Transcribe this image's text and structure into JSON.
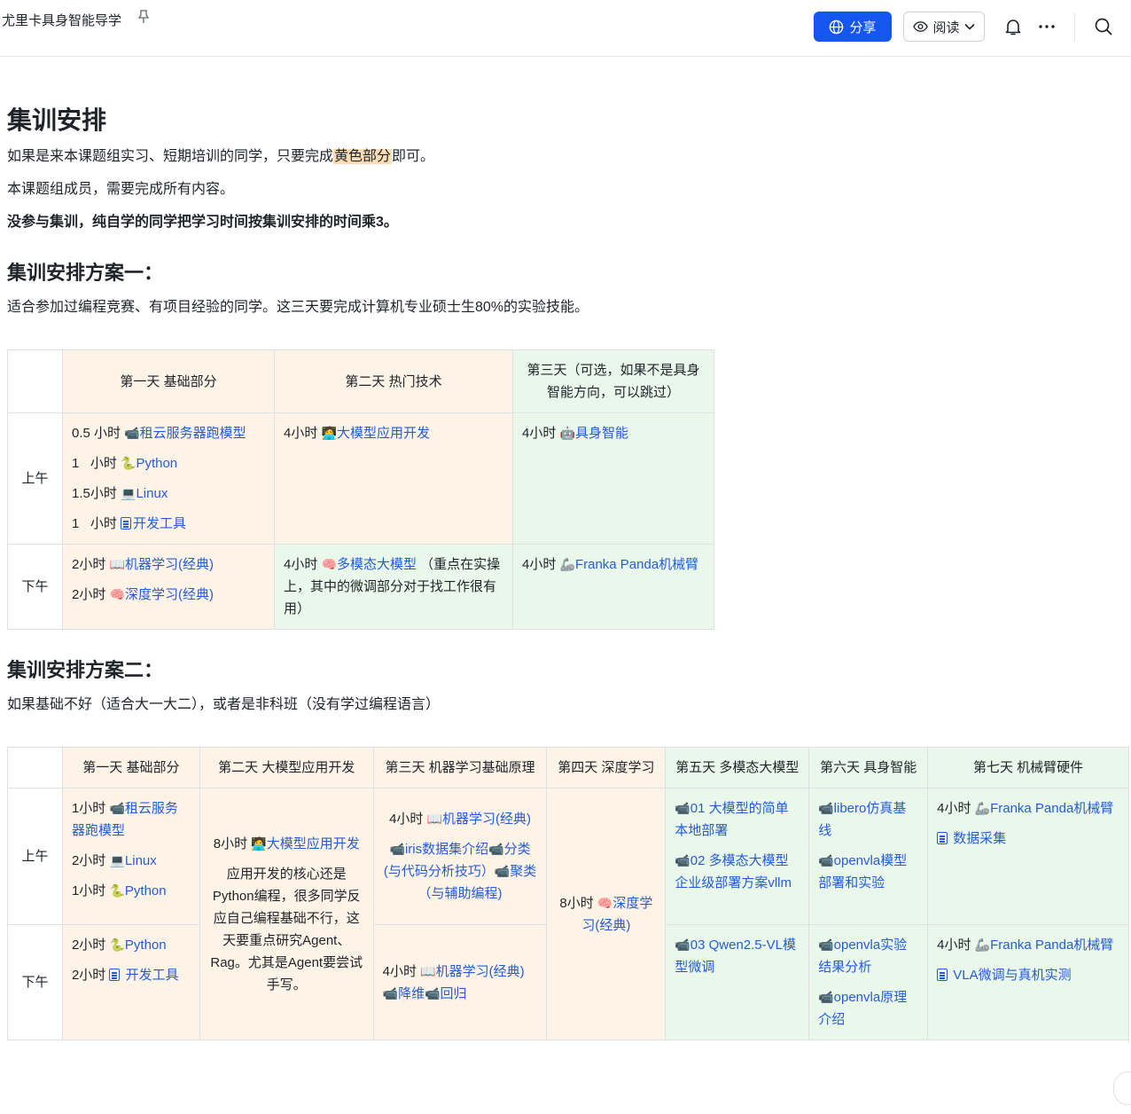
{
  "header": {
    "doc_title": "尤里卡具身智能导学",
    "share_label": "分享",
    "read_label": "阅读"
  },
  "intro": {
    "title": "集训安排",
    "p1_before": "如果是来本课题组实习、短期培训的同学，只要完成",
    "p1_highlight": "黄色部分",
    "p1_after": "即可。",
    "p2": "本课题组成员，需要完成所有内容。",
    "p3": "没参与集训，纯自学的同学把学习时间按集训安排的时间乘3。"
  },
  "plan1": {
    "title": "集训安排方案一：",
    "desc": "适合参加过编程竞赛、有项目经验的同学。这三天要完成计算机专业硕士生80%的实验技能。",
    "headers": [
      "第一天 基础部分",
      "第二天 热门技术",
      "第三天（可选，如果不是具身智能方向，可以跳过）"
    ],
    "row_am": "上午",
    "row_pm": "下午",
    "d1_am": [
      {
        "time": "0.5 小时 ",
        "icon": "📹",
        "link": "租云服务器跑模型"
      },
      {
        "time": "1   小时 ",
        "icon": "🐍",
        "link": "Python"
      },
      {
        "time": "1.5小时 ",
        "icon": "💻",
        "link": "Linux"
      },
      {
        "time": "1   小时 ",
        "icon": "doc",
        "link": "开发工具"
      }
    ],
    "d2_am": {
      "time": "4小时 ",
      "icon": "🧑‍💻",
      "link": "大模型应用开发"
    },
    "d3_am": {
      "time": "4小时 ",
      "icon": "🤖",
      "link": "具身智能"
    },
    "d1_pm": [
      {
        "time": "2小时 ",
        "icon": "📖",
        "link": "机器学习(经典)"
      },
      {
        "time": "2小时 ",
        "icon": "🧠",
        "link": "深度学习(经典)"
      }
    ],
    "d2_pm": {
      "time": "4小时 ",
      "icon": "🧠",
      "link": "多模态大模型",
      "note": " （重点在实操上，其中的微调部分对于找工作很有用）"
    },
    "d3_pm": {
      "time": "4小时 ",
      "icon": "🦾",
      "link": "Franka Panda机械臂"
    }
  },
  "plan2": {
    "title": "集训安排方案二：",
    "desc": "如果基础不好（适合大一大二），或者是非科班（没有学过编程语言）",
    "headers": [
      "第一天 基础部分",
      "第二天 大模型应用开发",
      "第三天 机器学习基础原理",
      "第四天 深度学习",
      "第五天 多模态大模型",
      "第六天 具身智能",
      "第七天 机械臂硬件"
    ],
    "row_am": "上午",
    "row_pm": "下午",
    "d1_am": [
      {
        "time": "1小时 ",
        "icon": "📹",
        "link": "租云服务器跑模型"
      },
      {
        "time": "2小时 ",
        "icon": "💻",
        "link": "Linux"
      },
      {
        "time": "1小时 ",
        "icon": "🐍",
        "link": "Python"
      }
    ],
    "d1_pm": [
      {
        "time": "2小时 ",
        "icon": "🐍",
        "link": "Python"
      },
      {
        "time": "2小时 ",
        "icon": "doc",
        "link": "开发工具"
      }
    ],
    "d2": {
      "time": "8小时 ",
      "icon": "🧑‍💻",
      "link": "大模型应用开发",
      "note": "应用开发的核心还是Python编程，很多同学反应自己编程基础不行，这天要重点研究Agent、Rag。尤其是Agent要尝试手写。"
    },
    "d3_am_line1": {
      "time": "4小时 ",
      "icon": "📖",
      "link": "机器学习(经典)"
    },
    "d3_am_links": [
      {
        "icon": "📹",
        "link": "iris数据集介绍"
      },
      {
        "icon": "📹",
        "link": "分类(与代码分析技巧）"
      },
      {
        "icon": "📹",
        "link": "聚类（与辅助编程)"
      }
    ],
    "d3_pm_line1": {
      "time": "4小时 ",
      "icon": "📖",
      "link": "机器学习(经典)"
    },
    "d3_pm_links": [
      {
        "icon": "📹",
        "link": "降维"
      },
      {
        "icon": "📹",
        "link": "回归"
      }
    ],
    "d4": {
      "time": "8小时 ",
      "icon": "🧠",
      "link": "深度学习(经典)"
    },
    "d5_am": [
      {
        "icon": "📹",
        "link": "01 大模型的简单本地部署"
      },
      {
        "icon": "📹",
        "link": "02 多模态大模型企业级部署方案vllm"
      }
    ],
    "d5_pm": [
      {
        "icon": "📹",
        "link": "03 Qwen2.5-VL模型微调"
      }
    ],
    "d6_am": [
      {
        "icon": "📹",
        "link": "libero仿真基线"
      },
      {
        "icon": "📹",
        "link": "openvla模型部署和实验"
      }
    ],
    "d6_pm": [
      {
        "icon": "📹",
        "link": "openvla实验结果分析"
      },
      {
        "icon": "📹",
        "link": "openvla原理介绍"
      }
    ],
    "d7_am": [
      {
        "time": "4小时 ",
        "icon": "🦾",
        "link": "Franka Panda机械臂"
      },
      {
        "time": "",
        "icon": "doc",
        "link": "数据采集"
      }
    ],
    "d7_pm": [
      {
        "time": "4小时 ",
        "icon": "🦾",
        "link": "Franka Panda机械臂"
      },
      {
        "time": "",
        "icon": "doc",
        "link": "VLA微调与真机实测"
      }
    ]
  },
  "colors": {
    "accent": "#1456f0",
    "link": "#245bdb",
    "peach_cell": "#fef3e7",
    "green_cell": "#eaf8ec",
    "highlight": "#fbdcb4"
  }
}
